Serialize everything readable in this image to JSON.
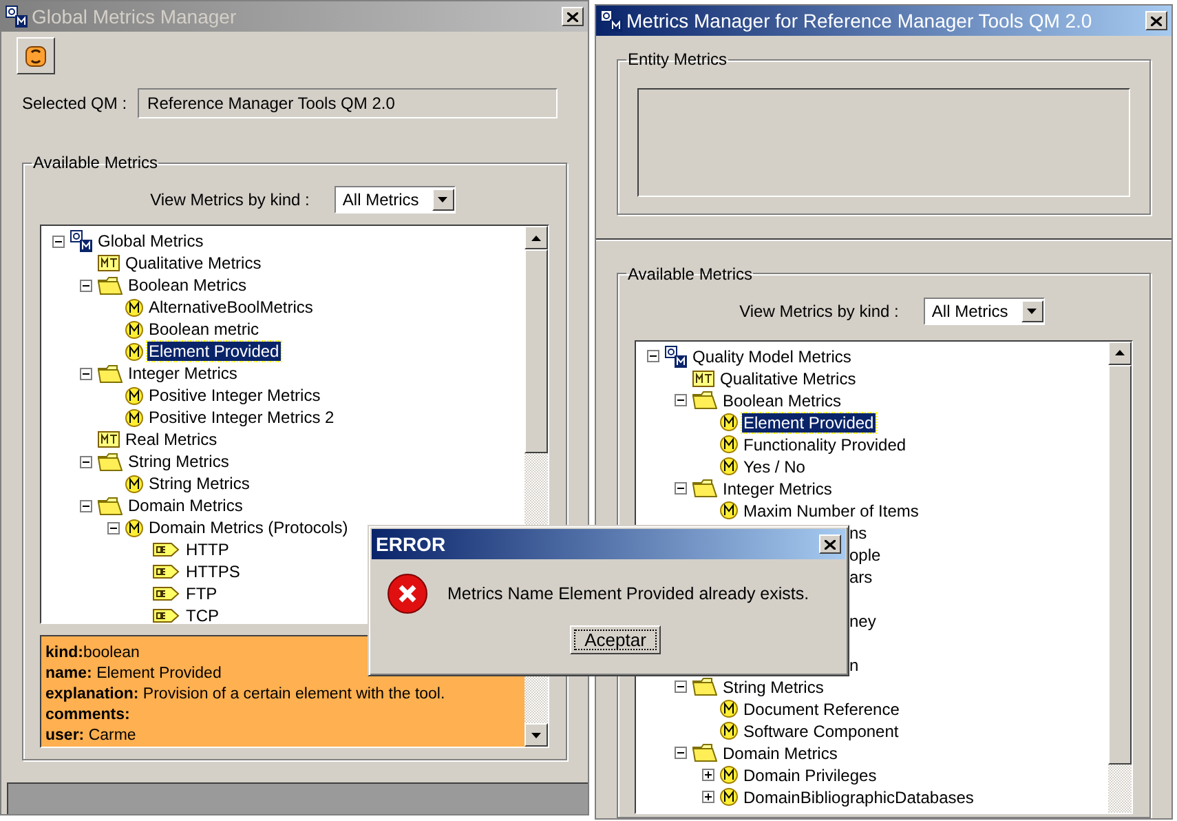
{
  "left_window": {
    "title": "Global Metrics Manager",
    "active": false,
    "selected_qm": {
      "label": "Selected QM :",
      "value": "Reference Manager Tools QM 2.0"
    },
    "available_metrics": {
      "title": "Available Metrics",
      "filter": {
        "label": "View Metrics by kind :",
        "value": "All Metrics"
      },
      "tree": [
        {
          "label": "Global Metrics",
          "kind": "root",
          "selected": false,
          "expanded": true,
          "children": [
            {
              "label": "Qualitative Metrics",
              "kind": "category",
              "selected": false
            },
            {
              "label": "Boolean Metrics",
              "kind": "folder",
              "selected": false,
              "expanded": true,
              "children": [
                {
                  "label": "AlternativeBoolMetrics",
                  "kind": "metric",
                  "selected": false
                },
                {
                  "label": "Boolean metric",
                  "kind": "metric",
                  "selected": false
                },
                {
                  "label": "Element Provided",
                  "kind": "metric",
                  "selected": true
                }
              ]
            },
            {
              "label": "Integer Metrics",
              "kind": "folder",
              "selected": false,
              "expanded": true,
              "children": [
                {
                  "label": "Positive Integer Metrics",
                  "kind": "metric",
                  "selected": false
                },
                {
                  "label": "Positive Integer Metrics 2",
                  "kind": "metric",
                  "selected": false
                }
              ]
            },
            {
              "label": "Real Metrics",
              "kind": "category",
              "selected": false
            },
            {
              "label": "String Metrics",
              "kind": "folder",
              "selected": false,
              "expanded": true,
              "children": [
                {
                  "label": "String Metrics",
                  "kind": "metric",
                  "selected": false
                }
              ]
            },
            {
              "label": "Domain Metrics",
              "kind": "folder",
              "selected": false,
              "expanded": true,
              "children": [
                {
                  "label": "Domain Metrics (Protocols)",
                  "kind": "metric",
                  "selected": false,
                  "expanded": true,
                  "children": [
                    {
                      "label": "HTTP",
                      "kind": "value",
                      "selected": false
                    },
                    {
                      "label": "HTTPS",
                      "kind": "value",
                      "selected": false
                    },
                    {
                      "label": "FTP",
                      "kind": "value",
                      "selected": false
                    },
                    {
                      "label": "TCP",
                      "kind": "value",
                      "selected": false
                    }
                  ]
                }
              ]
            }
          ]
        }
      ],
      "details": [
        "**kind:**boolean",
        "**name:** Element Provided",
        "**explanation:** Provision of a certain element with the tool.",
        "**comments:**",
        "**user:** Carme"
      ]
    }
  },
  "right_window": {
    "title": "Metrics Manager for Reference Manager Tools QM 2.0",
    "active": true,
    "entity_metrics": {
      "title": "Entity Metrics"
    },
    "available_metrics": {
      "title": "Available Metrics",
      "filter": {
        "label": "View Metrics by kind :",
        "value": "All Metrics"
      },
      "tree": [
        {
          "label": "Quality Model Metrics",
          "kind": "root",
          "selected": false,
          "expanded": true,
          "children": [
            {
              "label": "Qualitative Metrics",
              "kind": "category",
              "selected": false
            },
            {
              "label": "Boolean Metrics",
              "kind": "folder",
              "selected": false,
              "expanded": true,
              "children": [
                {
                  "label": "Element Provided",
                  "kind": "metric",
                  "selected": true
                },
                {
                  "label": "Functionality Provided",
                  "kind": "metric",
                  "selected": false
                },
                {
                  "label": "Yes / No",
                  "kind": "metric",
                  "selected": false
                }
              ]
            },
            {
              "label": "Integer Metrics",
              "kind": "folder",
              "selected": false,
              "expanded": true,
              "children": [
                {
                  "label": "Maxim Number of Items",
                  "kind": "metric",
                  "selected": false
                },
                {
                  "label": "ns",
                  "kind": "fragment",
                  "selected": false
                },
                {
                  "label": "ople",
                  "kind": "fragment",
                  "selected": false
                },
                {
                  "label": "ars",
                  "kind": "fragment",
                  "selected": false
                },
                {
                  "kind": "covered"
                },
                {
                  "label": "ney",
                  "kind": "fragment",
                  "selected": false
                },
                {
                  "kind": "covered"
                },
                {
                  "label": "n",
                  "kind": "fragment",
                  "selected": false
                }
              ]
            },
            {
              "label": "String Metrics",
              "kind": "folder",
              "selected": false,
              "expanded": true,
              "children": [
                {
                  "label": "Document Reference",
                  "kind": "metric",
                  "selected": false
                },
                {
                  "label": "Software Component",
                  "kind": "metric",
                  "selected": false
                }
              ]
            },
            {
              "label": "Domain Metrics",
              "kind": "folder",
              "selected": false,
              "expanded": true,
              "children": [
                {
                  "label": "Domain Privileges",
                  "kind": "metric",
                  "selected": false,
                  "expanded": false
                },
                {
                  "label": "DomainBibliographicDatabases",
                  "kind": "metric",
                  "selected": false,
                  "expanded": false
                }
              ]
            }
          ]
        }
      ]
    }
  },
  "dialog": {
    "title": "ERROR",
    "message": "Metrics Name Element Provided already exists.",
    "button": "Aceptar"
  }
}
